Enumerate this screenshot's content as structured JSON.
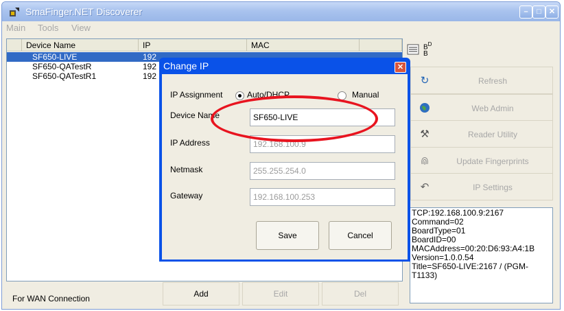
{
  "app": {
    "title": "SmaFinger.NET Discoverer"
  },
  "menu": {
    "items": [
      "Main",
      "Tools",
      "View"
    ]
  },
  "list": {
    "columns": [
      "Device Name",
      "IP",
      "MAC"
    ],
    "rows": [
      {
        "name": "SF650-LIVE",
        "ip": "192",
        "selected": true
      },
      {
        "name": "SF650-QATestR",
        "ip": "192",
        "selected": false
      },
      {
        "name": "SF650-QATestR1",
        "ip": "192",
        "selected": false
      }
    ]
  },
  "bottom": {
    "label": "For WAN Connection",
    "add": "Add",
    "edit": "Edit",
    "del": "Del"
  },
  "right_panel": {
    "toolbar": {
      "list_view_icon": "list-view-icon",
      "detail_icon_text": "BD\nBD"
    },
    "buttons": [
      {
        "label": "Refresh",
        "icon": "refresh-icon"
      },
      {
        "label": "Web Admin",
        "icon": "globe-icon"
      },
      {
        "label": "Reader Utility",
        "icon": "tools-icon"
      },
      {
        "label": "Update Fingerprints",
        "icon": "fingerprint-icon"
      },
      {
        "label": "IP Settings",
        "icon": "ip-settings-icon"
      }
    ],
    "info_lines": [
      "TCP:192.168.100.9:2167",
      "Command=02",
      "BoardType=01",
      "BoardID=00",
      "MACAddress=00:20:D6:93:A4:1B",
      "Version=1.0.0.54",
      "Title=SF650-LIVE:2167 / (PGM-T1133)"
    ]
  },
  "dialog": {
    "title": "Change IP",
    "ip_assignment_label": "IP Assignment",
    "auto_dhcp_label": "Auto/DHCP",
    "manual_label": "Manual",
    "auto_selected": true,
    "device_name_label": "Device Name",
    "device_name_value": "SF650-LIVE",
    "ip_address_label": "IP Address",
    "ip_address_value": "192.168.100.9",
    "netmask_label": "Netmask",
    "netmask_value": "255.255.254.0",
    "gateway_label": "Gateway",
    "gateway_value": "192.168.100.253",
    "save": "Save",
    "cancel": "Cancel"
  },
  "colors": {
    "titlebar": "#a9c3ee",
    "selection": "#316ac5",
    "dialog_frame": "#0a52e8",
    "highlight_ellipse": "#e8141f"
  }
}
